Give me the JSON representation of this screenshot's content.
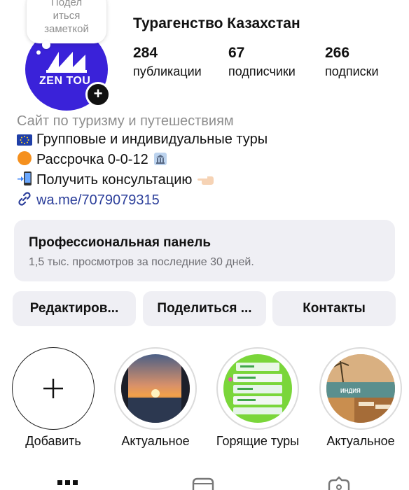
{
  "note": {
    "text_line1": "Подел",
    "text_line2": "иться",
    "text_line3": "заметкой"
  },
  "profile": {
    "avatar_logo_text": "ZEN TOU",
    "name": "Турагенство Казахстан",
    "stats": [
      {
        "value": "284",
        "label": "публикации"
      },
      {
        "value": "67",
        "label": "подписчики"
      },
      {
        "value": "266",
        "label": "подписки"
      }
    ]
  },
  "bio": {
    "category": "Сайт по туризму и путешествиям",
    "lines": [
      {
        "icon": "eu-flag-icon",
        "text": "Групповые и индивидуальные туры"
      },
      {
        "icon": "orange-circle-icon",
        "text": "Рассрочка 0-0-12"
      },
      {
        "icon": "mobile-phone-icon",
        "text": "Получить консультацию"
      }
    ],
    "link": "wa.me/7079079315"
  },
  "pro_panel": {
    "title": "Профессиональная панель",
    "subtitle": "1,5 тыс. просмотров за последние 30 дней."
  },
  "buttons": {
    "edit": "Редактиров...",
    "share": "Поделиться ...",
    "contacts": "Контакты"
  },
  "highlights": [
    {
      "label": "Добавить"
    },
    {
      "label": "Актуальное"
    },
    {
      "label": "Горящие туры"
    },
    {
      "label": "Актуальное"
    }
  ],
  "highlight_overlay_text": "ИНДИЯ",
  "colors": {
    "avatar_bg": "#3a22d9",
    "panel_bg": "#efeff4",
    "link": "#2b3e9a",
    "muted": "#8e8e8e"
  }
}
